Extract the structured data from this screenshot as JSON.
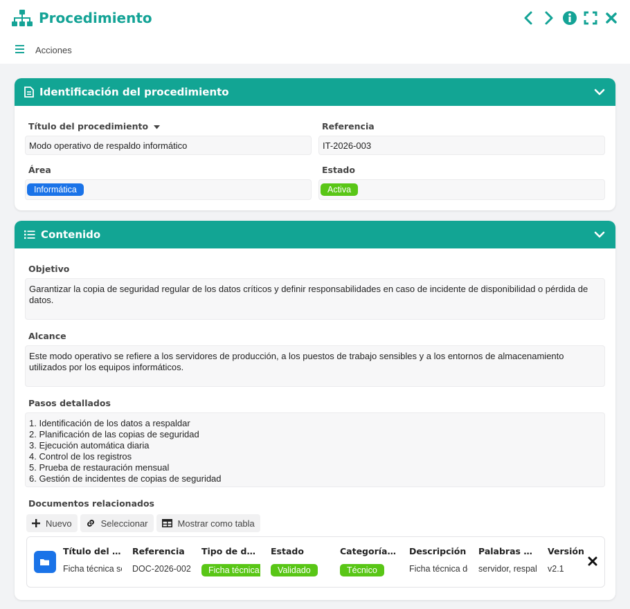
{
  "window": {
    "title": "Procedimiento"
  },
  "toolbar": {
    "actions_label": "Acciones"
  },
  "identificacion": {
    "header": "Identificación del procedimiento",
    "titulo_label": "Título del procedimiento",
    "titulo_value": "Modo operativo de respaldo informático",
    "referencia_label": "Referencia",
    "referencia_value": "IT-2026-003",
    "area_label": "Área",
    "area_value": "Informática",
    "estado_label": "Estado",
    "estado_value": "Activa"
  },
  "contenido": {
    "header": "Contenido",
    "objetivo_label": "Objetivo",
    "objetivo_value": "Garantizar la copia de seguridad regular de los datos críticos y definir responsabilidades en caso de incidente de disponibilidad o pérdida de datos.",
    "alcance_label": "Alcance",
    "alcance_value": "Este modo operativo se refiere a los servidores de producción, a los puestos de trabajo sensibles y a los entornos de almacenamiento utilizados por los equipos informáticos.",
    "pasos_label": "Pasos detallados",
    "pasos": [
      "1. Identificación de los datos a respaldar",
      "2. Planificación de las copias de seguridad",
      "3. Ejecución automática diaria",
      "4. Control de los registros",
      "5. Prueba de restauración mensual",
      "6. Gestión de incidentes de copias de seguridad"
    ],
    "docs_label": "Documentos relacionados",
    "btn_nuevo": "Nuevo",
    "btn_seleccionar": "Seleccionar",
    "btn_tabla": "Mostrar como tabla",
    "doc_columns": [
      "Título del documento",
      "Referencia",
      "Tipo de documento",
      "Estado",
      "Categoría documental",
      "Descripción",
      "Palabras clave",
      "Versión"
    ],
    "doc_row": {
      "titulo": "Ficha técnica servidor",
      "referencia": "DOC-2026-002",
      "tipo": "Ficha técnica",
      "estado": "Validado",
      "categoria": "Técnico",
      "descripcion": "Ficha técnica del servidor",
      "palabras": "servidor, respaldo",
      "version": "v2.1"
    }
  },
  "colors": {
    "accent": "#12a594",
    "title": "#14a396",
    "blue": "#1a73e8",
    "green": "#59c616"
  },
  "icons": [
    "sitemap-icon",
    "chevron-left-icon",
    "chevron-right-icon",
    "info-icon",
    "expand-icon",
    "close-icon",
    "menu-icon",
    "document-icon",
    "list-icon",
    "chevron-down-icon",
    "plus-icon",
    "link-icon",
    "table-icon",
    "folder-icon"
  ]
}
